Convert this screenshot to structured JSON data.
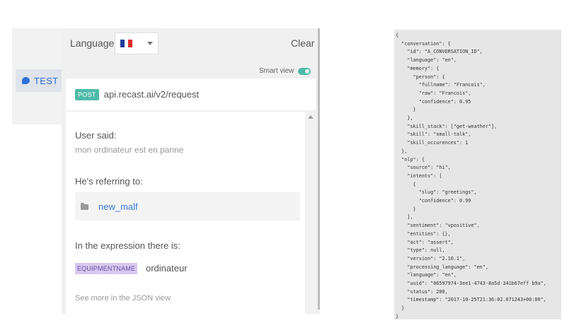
{
  "sidebar": {
    "test_tab_label": "TEST"
  },
  "header": {
    "language_label": "Language",
    "language_selected": "French",
    "flag_colors": [
      "#1f3d9c",
      "#ffffff",
      "#e02a2a"
    ],
    "clear_label": "Clear"
  },
  "smart_view": {
    "label": "Smart view",
    "enabled": true
  },
  "request": {
    "method": "POST",
    "url": "api.recast.ai/v2/request"
  },
  "analysis": {
    "user_said_label": "User said:",
    "user_said_value": "mon ordinateur est en panne",
    "referring_label": "He's referring to:",
    "referring_value": "new_malf",
    "expression_label": "In the expression there is:",
    "entity_tag": "EQUIPMENTNAME",
    "entity_value": "ordinateur",
    "see_more": "See more in the JSON view"
  },
  "json_view": {
    "lines": [
      "{",
      "  \"conversation\": {",
      "    \"id\": \"A_CONVERSATION_ID\",",
      "    \"language\": \"en\",",
      "    \"memory\": {",
      "      \"person\": {",
      "        \"fullname\": \"Francois\",",
      "        \"raw\": \"Francois\",",
      "        \"confidence\": 0.95",
      "      }",
      "    },",
      "    \"skill_stack\": [\"get-weather\"],",
      "    \"skill\": \"small-talk\",",
      "    \"skill_occurences\": 1",
      "  },",
      "  \"nlp\": {",
      "    \"source\": \"hi\",",
      "    \"intents\": [",
      "      {",
      "        \"slug\": \"greetings\",",
      "        \"confidence\": 0.99",
      "      }",
      "    ],",
      "    \"sentiment\": \"vpositive\",",
      "    \"entities\": {},",
      "    \"act\": \"assert\",",
      "    \"type\": null,",
      "    \"version\": \"2.10.1\",",
      "    \"processing_language\": \"en\",",
      "    \"language\": \"en\",",
      "    \"uuid\": \"06597974-3ee1-4743-8a5d-341b67eff b9a\",",
      "    \"status\": 200,",
      "    \"timestamp\": \"2017-10-25T21:36:02.071243+00:00\",",
      "  }",
      "}"
    ]
  }
}
